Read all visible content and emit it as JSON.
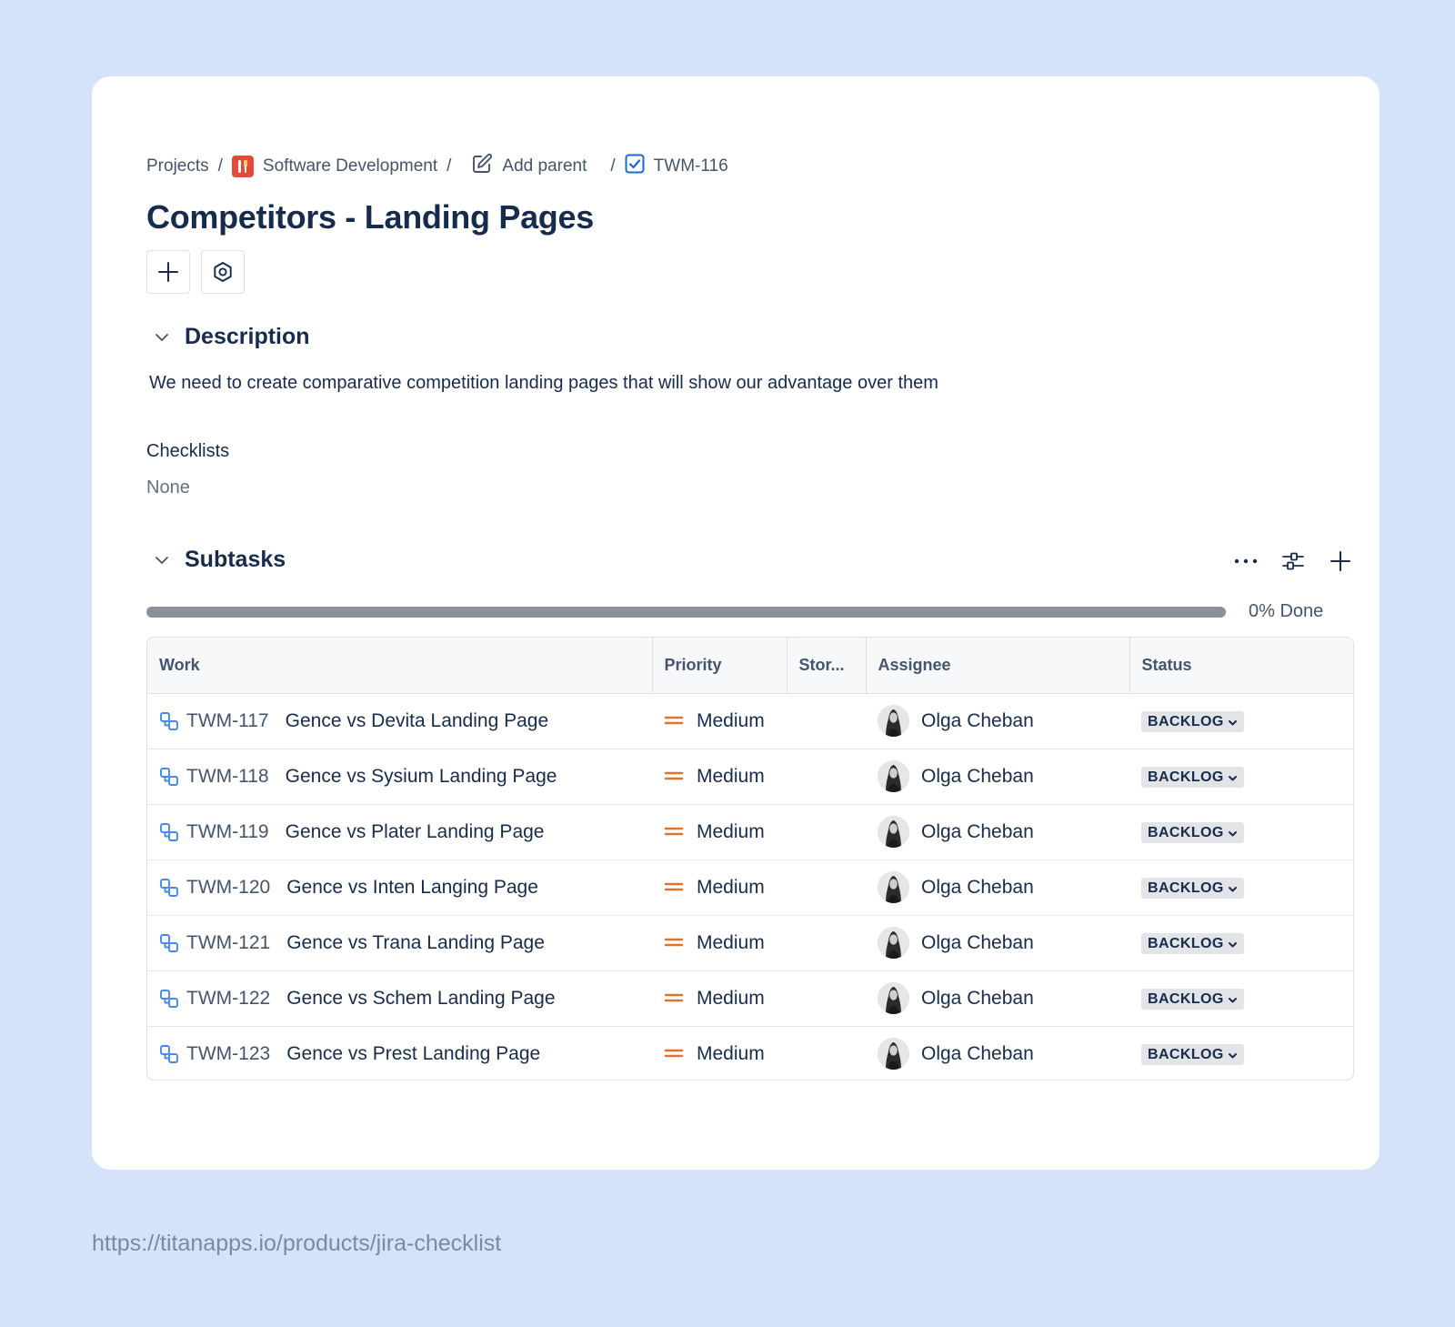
{
  "breadcrumb": {
    "projects": "Projects",
    "project": "Software Development",
    "add_parent": "Add parent",
    "issue_key": "TWM-116",
    "separator": "/"
  },
  "issue": {
    "title": "Competitors - Landing Pages"
  },
  "description": {
    "heading": "Description",
    "text": "We need to create comparative competition landing pages that will show our advantage over them"
  },
  "checklists": {
    "label": "Checklists",
    "value": "None"
  },
  "subtasks": {
    "heading": "Subtasks",
    "progress_percent": 0,
    "progress_label": "0% Done",
    "columns": {
      "work": "Work",
      "priority": "Priority",
      "story_points": "Stor...",
      "assignee": "Assignee",
      "status": "Status"
    },
    "rows": [
      {
        "key": "TWM-117",
        "summary": "Gence vs Devita Landing Page",
        "priority": "Medium",
        "assignee": "Olga Cheban",
        "status": "BACKLOG"
      },
      {
        "key": "TWM-118",
        "summary": "Gence vs Sysium Landing Page",
        "priority": "Medium",
        "assignee": "Olga Cheban",
        "status": "BACKLOG"
      },
      {
        "key": "TWM-119",
        "summary": "Gence vs Plater Landing Page",
        "priority": "Medium",
        "assignee": "Olga Cheban",
        "status": "BACKLOG"
      },
      {
        "key": "TWM-120",
        "summary": "Gence vs Inten Langing Page",
        "priority": "Medium",
        "assignee": "Olga Cheban",
        "status": "BACKLOG"
      },
      {
        "key": "TWM-121",
        "summary": "Gence vs Trana Landing Page",
        "priority": "Medium",
        "assignee": "Olga Cheban",
        "status": "BACKLOG"
      },
      {
        "key": "TWM-122",
        "summary": "Gence vs Schem Landing Page",
        "priority": "Medium",
        "assignee": "Olga Cheban",
        "status": "BACKLOG"
      },
      {
        "key": "TWM-123",
        "summary": "Gence vs Prest Landing Page",
        "priority": "Medium",
        "assignee": "Olga Cheban",
        "status": "BACKLOG"
      }
    ]
  },
  "icons": {
    "project": "project-tools-icon",
    "add_parent": "edit-icon",
    "issue_type": "task-checkbox-icon",
    "subtask": "subtask-icon",
    "priority": "priority-medium-icon",
    "status_dropdown": "chevron-down-icon"
  },
  "colors": {
    "background": "#d4e3f9",
    "priority_medium": "#e2732d",
    "subtask_icon": "#4688ec",
    "task_icon": "#1868db",
    "project_icon": "#e5493a",
    "status_pill": "#e2e4e8"
  },
  "footer": {
    "url": "https://titanapps.io/products/jira-checklist"
  }
}
